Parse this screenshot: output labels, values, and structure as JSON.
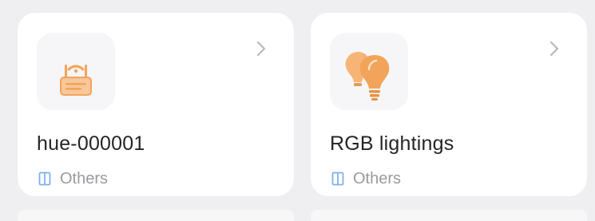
{
  "colors": {
    "background": "#efeff2",
    "card": "#ffffff",
    "icon_tile": "#f6f6f8",
    "accent_orange": "#f2a45a",
    "room_icon_blue": "#7fb0e6",
    "text_primary": "#252528",
    "text_secondary": "#9a9aa0"
  },
  "devices": [
    {
      "name": "hue-000001",
      "icon": "router-icon",
      "room_icon": "room-icon",
      "room": "Others"
    },
    {
      "name": "RGB lightings",
      "icon": "lightbulbs-icon",
      "room_icon": "room-icon",
      "room": "Others"
    }
  ]
}
